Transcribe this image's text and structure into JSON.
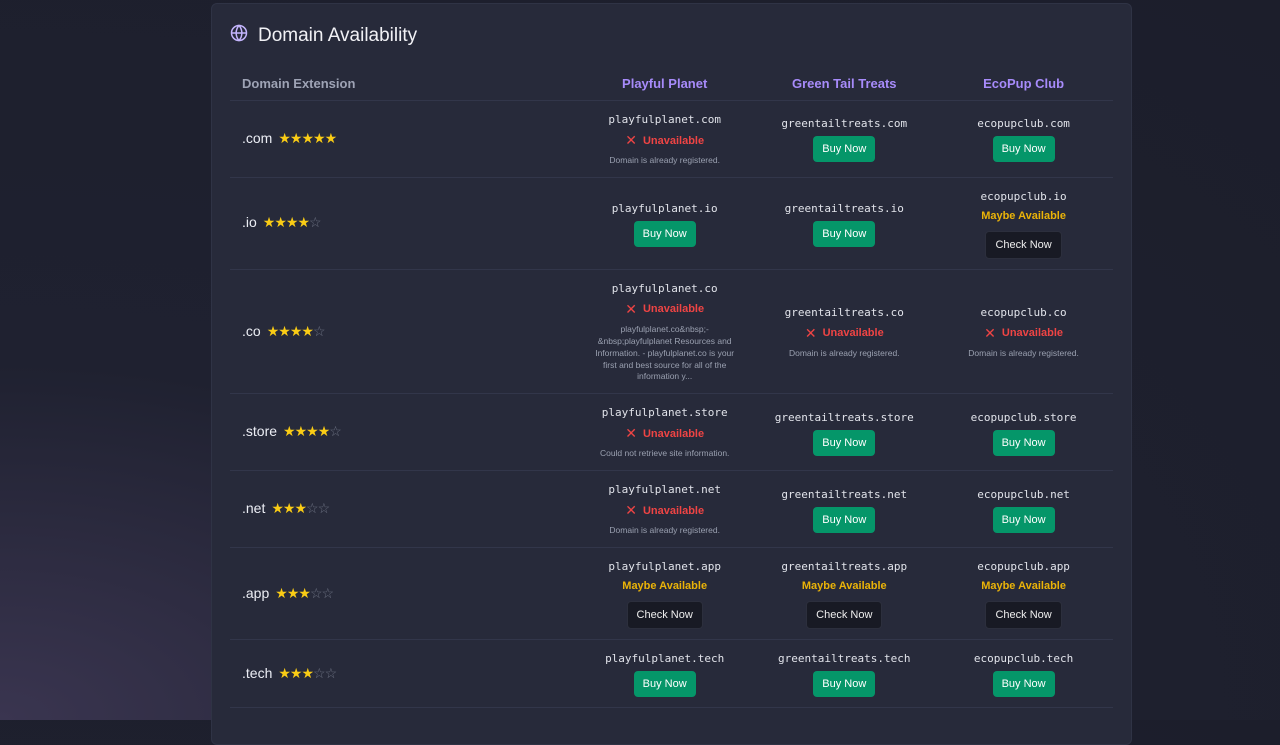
{
  "title": "Domain Availability",
  "headers": {
    "extension": "Domain Extension",
    "sites": [
      "Playful Planet",
      "Green Tail Treats",
      "EcoPup Club"
    ]
  },
  "colors": {
    "accent": "#a78bfa",
    "buy": "#059669",
    "unavailable": "#ef4444",
    "maybe": "#eab308",
    "star": "#facc15"
  },
  "rows": [
    {
      "ext": ".com",
      "stars": 5,
      "cells": [
        {
          "domain": "playfulplanet.com",
          "status": "unavailable",
          "status_label": "Unavailable",
          "note": "Domain is already registered."
        },
        {
          "domain": "greentailtreats.com",
          "status": "available",
          "button": "Buy Now"
        },
        {
          "domain": "ecopupclub.com",
          "status": "available",
          "button": "Buy Now"
        }
      ]
    },
    {
      "ext": ".io",
      "stars": 4,
      "cells": [
        {
          "domain": "playfulplanet.io",
          "status": "available",
          "button": "Buy Now"
        },
        {
          "domain": "greentailtreats.io",
          "status": "available",
          "button": "Buy Now"
        },
        {
          "domain": "ecopupclub.io",
          "status": "maybe",
          "status_label": "Maybe Available",
          "button": "Check Now"
        }
      ]
    },
    {
      "ext": ".co",
      "stars": 4,
      "cells": [
        {
          "domain": "playfulplanet.co",
          "status": "unavailable",
          "status_label": "Unavailable",
          "note": "playfulplanet.co&nbsp;-&nbsp;playfulplanet Resources and Information. - playfulplanet.co is your first and best source for all of the information y..."
        },
        {
          "domain": "greentailtreats.co",
          "status": "unavailable",
          "status_label": "Unavailable",
          "note": "Domain is already registered."
        },
        {
          "domain": "ecopupclub.co",
          "status": "unavailable",
          "status_label": "Unavailable",
          "note": "Domain is already registered."
        }
      ]
    },
    {
      "ext": ".store",
      "stars": 4,
      "cells": [
        {
          "domain": "playfulplanet.store",
          "status": "unavailable",
          "status_label": "Unavailable",
          "note": "Could not retrieve site information."
        },
        {
          "domain": "greentailtreats.store",
          "status": "available",
          "button": "Buy Now"
        },
        {
          "domain": "ecopupclub.store",
          "status": "available",
          "button": "Buy Now"
        }
      ]
    },
    {
      "ext": ".net",
      "stars": 3,
      "cells": [
        {
          "domain": "playfulplanet.net",
          "status": "unavailable",
          "status_label": "Unavailable",
          "note": "Domain is already registered."
        },
        {
          "domain": "greentailtreats.net",
          "status": "available",
          "button": "Buy Now"
        },
        {
          "domain": "ecopupclub.net",
          "status": "available",
          "button": "Buy Now"
        }
      ]
    },
    {
      "ext": ".app",
      "stars": 3,
      "cells": [
        {
          "domain": "playfulplanet.app",
          "status": "maybe",
          "status_label": "Maybe Available",
          "button": "Check Now"
        },
        {
          "domain": "greentailtreats.app",
          "status": "maybe",
          "status_label": "Maybe Available",
          "button": "Check Now"
        },
        {
          "domain": "ecopupclub.app",
          "status": "maybe",
          "status_label": "Maybe Available",
          "button": "Check Now"
        }
      ]
    },
    {
      "ext": ".tech",
      "stars": 3,
      "cells": [
        {
          "domain": "playfulplanet.tech",
          "status": "available",
          "button": "Buy Now"
        },
        {
          "domain": "greentailtreats.tech",
          "status": "available",
          "button": "Buy Now"
        },
        {
          "domain": "ecopupclub.tech",
          "status": "available",
          "button": "Buy Now"
        }
      ]
    }
  ]
}
